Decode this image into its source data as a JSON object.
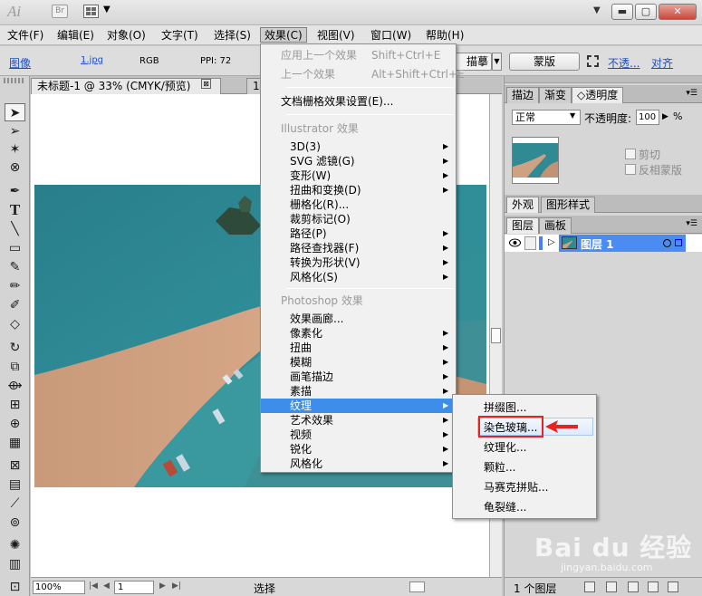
{
  "titlebar": {
    "logo": "Ai",
    "bridge_label": "Br",
    "minimize": "▬",
    "maximize": "▢",
    "close": "✕"
  },
  "menubar": {
    "items": [
      "文件(F)",
      "编辑(E)",
      "对象(O)",
      "文字(T)",
      "选择(S)",
      "效果(C)",
      "视图(V)",
      "窗口(W)",
      "帮助(H)"
    ]
  },
  "controlbar": {
    "image_label": "图像",
    "file_name": "1.jpg",
    "color_mode": "RGB",
    "ppi": "PPI: 72",
    "trace_label": "描摹",
    "mask_button": "蒙版",
    "opacity_link": "不透...",
    "align_link": "对齐"
  },
  "document": {
    "tab1": "未标题-1 @ 33% (CMYK/预览)",
    "tab1_close": "⊠",
    "tab2": "1.jpg @"
  },
  "statusbar": {
    "zoom": "100%",
    "page": "1",
    "mode": "选择"
  },
  "panels": {
    "top_tabs": [
      "描边",
      "渐变",
      "透明度"
    ],
    "blend_mode": "正常",
    "opacity_label": "不透明度:",
    "opacity_value": "100",
    "opacity_unit": "%",
    "clip_label": "剪切",
    "invert_label": "反相蒙版",
    "mid_tabs": [
      "外观",
      "图形样式"
    ],
    "layer_tabs": [
      "图层",
      "画板"
    ],
    "layer_name": "图层 1",
    "layer_count": "1 个图层"
  },
  "effect_menu": {
    "apply_last": "应用上一个效果",
    "apply_last_shortcut": "Shift+Ctrl+E",
    "last_effect": "上一个效果",
    "last_effect_shortcut": "Alt+Shift+Ctrl+E",
    "raster_settings": "文档栅格效果设置(E)...",
    "illustrator_header": "Illustrator 效果",
    "illustrator_items": [
      "3D(3)",
      "SVG 滤镜(G)",
      "变形(W)",
      "扭曲和变换(D)",
      "栅格化(R)...",
      "裁剪标记(O)",
      "路径(P)",
      "路径查找器(F)",
      "转换为形状(V)",
      "风格化(S)"
    ],
    "photoshop_header": "Photoshop 效果",
    "photoshop_items": [
      "效果画廊...",
      "像素化",
      "扭曲",
      "模糊",
      "画笔描边",
      "素描",
      "纹理",
      "艺术效果",
      "视频",
      "锐化",
      "风格化"
    ]
  },
  "texture_menu": {
    "items": [
      "拼缀图...",
      "染色玻璃...",
      "纹理化...",
      "颗粒...",
      "马赛克拼贴...",
      "龟裂缝..."
    ]
  },
  "watermark": {
    "brand": "Bai du 经验",
    "url": "jingyan.baidu.com"
  },
  "colors": {
    "menu_highlight": "#3d8ee8",
    "callout_red": "#e8231d",
    "layer_selected": "#4a8cf0"
  }
}
